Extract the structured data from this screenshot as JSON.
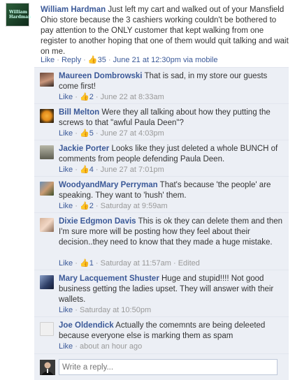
{
  "post": {
    "author": "William Hardman",
    "text": "Just left my cart and walked out of your Mansfield Ohio store because the 3 cashiers working couldn't be bothered to pay attention to the ONLY customer that kept walking from one register to another hoping that one of them would quit talking and wait on me.",
    "like_label": "Like",
    "reply_label": "Reply",
    "likes": "35",
    "timestamp": "June 21 at 12:30pm via mobile",
    "avatar_text": "William Hardman"
  },
  "comments": [
    {
      "author": "Maureen Dombrowski",
      "text": "That is sad, in my store our guests come first!",
      "like_label": "Like",
      "likes": "2",
      "timestamp": "June 22 at 8:33am",
      "edited": ""
    },
    {
      "author": "Bill Melton",
      "text": "Were they all talking about how they putting the screws to that \"awful Paula Deen\"?",
      "like_label": "Like",
      "likes": "5",
      "timestamp": "June 27 at 4:03pm",
      "edited": ""
    },
    {
      "author": "Jackie Porter",
      "text": "Looks like they just deleted a whole BUNCH of comments from people defending Paula Deen.",
      "like_label": "Like",
      "likes": "4",
      "timestamp": "June 27 at 7:01pm",
      "edited": ""
    },
    {
      "author": "WoodyandMary Perryman",
      "text": "That's because 'the people' are speaking. They want to 'hush' them.",
      "like_label": "Like",
      "likes": "2",
      "timestamp": "Saturday at 9:59am",
      "edited": ""
    },
    {
      "author": "Dixie Edgmon Davis",
      "text": "This is ok they can delete them and then I'm sure more will be posting how they feel about their decision..they need to know that they made a huge mistake.",
      "like_label": "Like",
      "likes": "1",
      "timestamp": "Saturday at 11:57am",
      "edited": "Edited"
    },
    {
      "author": "Mary Lacquement Shuster",
      "text": "Huge and stupid!!!! Not good business getting the ladies upset. They will answer with their wallets.",
      "like_label": "Like",
      "likes": "",
      "timestamp": "Saturday at 10:50pm",
      "edited": ""
    },
    {
      "author": "Joe Oldendick",
      "text": "Actually the comemnts are being deleeted because everyone else is marking them as spam",
      "like_label": "Like",
      "likes": "",
      "timestamp": "about an hour ago",
      "edited": ""
    }
  ],
  "reply_box": {
    "placeholder": "Write a reply..."
  },
  "icons": {
    "like": "thumbs-up-icon"
  },
  "colors": {
    "link": "#3b5998",
    "comment_bg": "#eceff5",
    "meta": "#999999"
  }
}
